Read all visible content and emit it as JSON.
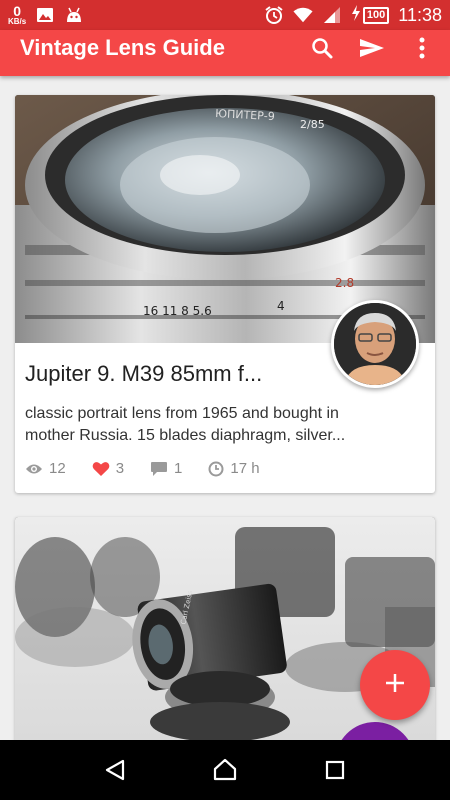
{
  "status_bar": {
    "net_speed": "0",
    "net_unit": "KB/s",
    "battery": "100",
    "time": "11:38",
    "icons": [
      "image-icon",
      "android-icon",
      "alarm-icon",
      "wifi-icon",
      "signal-icon",
      "charging-icon"
    ]
  },
  "app_bar": {
    "title": "Vintage Lens Guide",
    "actions": [
      "search-icon",
      "send-icon",
      "more-vert-icon"
    ]
  },
  "cards": [
    {
      "title": "Jupiter 9.  M39 85mm f...",
      "description_line1": "classic portrait lens from 1965 and bought in",
      "description_line2": "mother Russia.  15 blades diaphragm, silver...",
      "views": "12",
      "likes": "3",
      "comments": "1",
      "age": "17 h",
      "image_lettering": [
        "ЮПИТЕР-9",
        "2/85",
        "16 11 8  5.6",
        "4",
        "2.8"
      ]
    },
    {
      "image_lettering": [
        "Carl Zeiss"
      ]
    }
  ],
  "colors": {
    "status_bar": "#d32f2f",
    "app_bar": "#f44747",
    "fab": "#f44747",
    "fab_secondary": "#7b1fa2",
    "like": "#f44747"
  },
  "fab": {
    "icon": "plus-icon"
  },
  "nav": [
    "back-icon",
    "home-icon",
    "recents-icon"
  ]
}
